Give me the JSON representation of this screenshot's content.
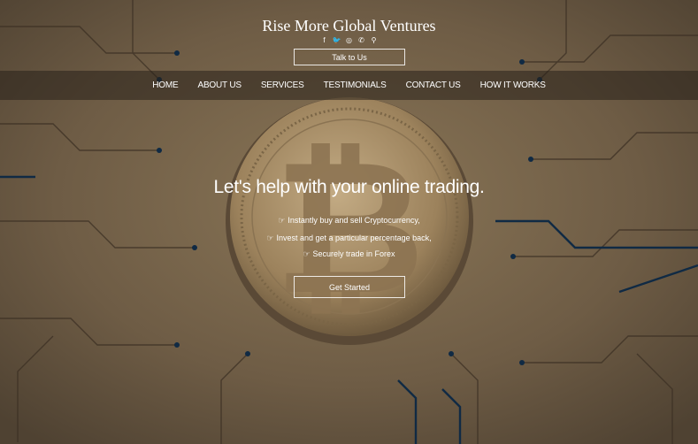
{
  "brand": {
    "title": "Rise More Global Ventures"
  },
  "socials": [
    {
      "icon": "facebook-icon",
      "glyph": "f"
    },
    {
      "icon": "twitter-icon",
      "glyph": "🐦"
    },
    {
      "icon": "instagram-icon",
      "glyph": "◎"
    },
    {
      "icon": "phone-icon",
      "glyph": "✆"
    },
    {
      "icon": "location-pin-icon",
      "glyph": "⚲"
    }
  ],
  "cta_top": {
    "label": "Talk to Us"
  },
  "nav": {
    "items": [
      "HOME",
      "ABOUT US",
      "SERVICES",
      "TESTIMONIALS",
      "CONTACT US",
      "HOW IT WORKS"
    ]
  },
  "hero": {
    "headline": "Let's help with your online trading.",
    "bullets": [
      "Instantly buy and sell Cryptocurrency,",
      "Invest and get a particular percentage back,",
      "Securely trade in Forex"
    ],
    "bullet_icon": "☞",
    "button_label": "Get Started"
  },
  "colors": {
    "background": "#6b5a44",
    "coin": "#a08660",
    "trace": "#102a44"
  }
}
